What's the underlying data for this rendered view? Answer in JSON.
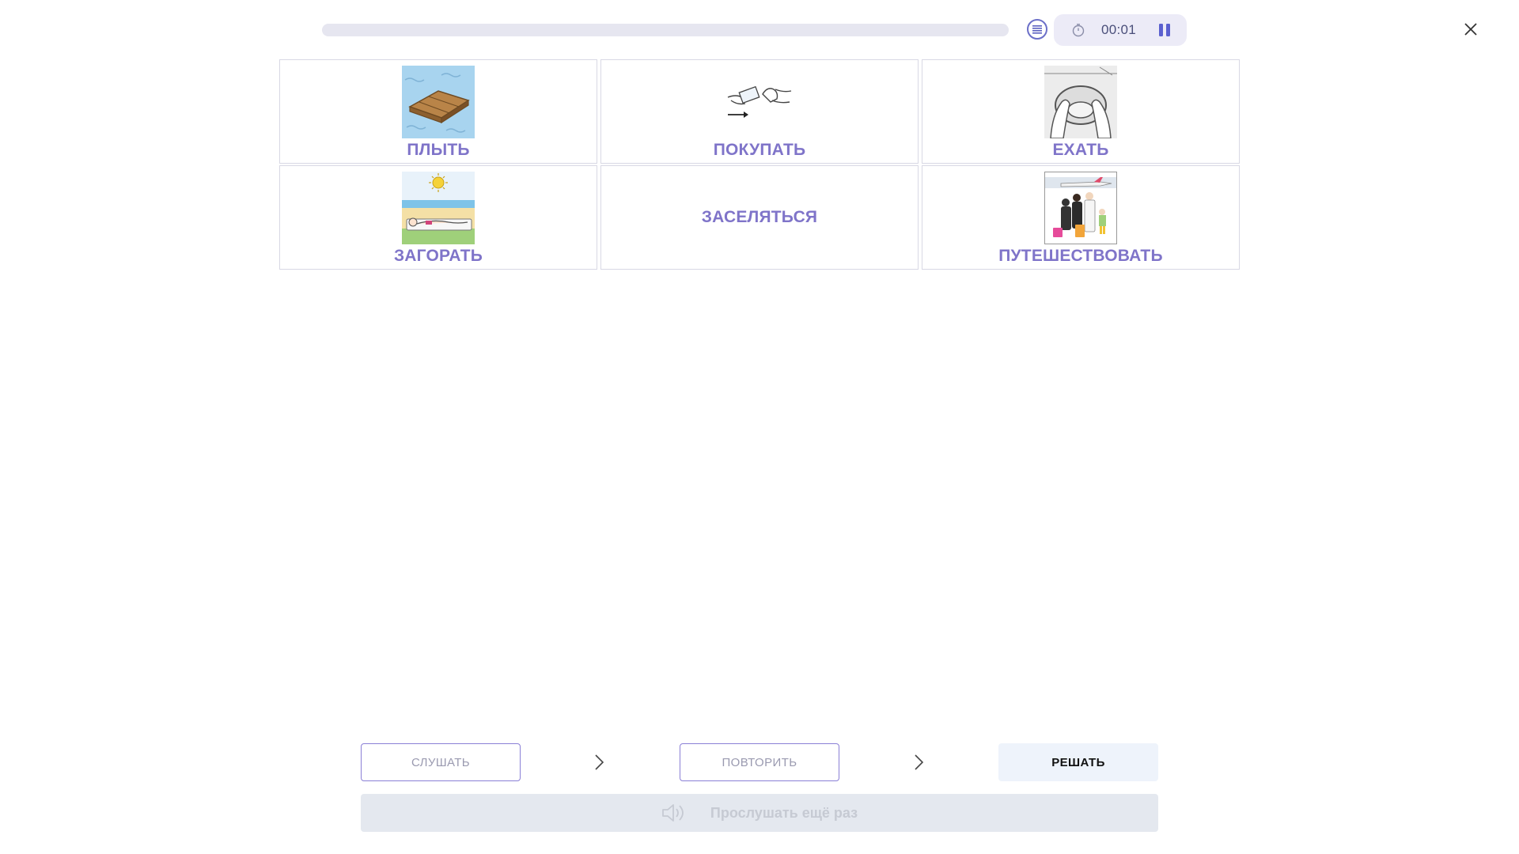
{
  "header": {
    "progress": 0,
    "timer": "00:01",
    "icons": {
      "list": "list-icon",
      "timer": "stopwatch-icon",
      "pause": "pause-icon",
      "close": "close-icon"
    }
  },
  "cards": [
    {
      "label": "ПЛЫТЬ",
      "picture": "raft-on-water"
    },
    {
      "label": "ПОКУПАТЬ",
      "picture": "paying-money"
    },
    {
      "label": "ЕХАТЬ",
      "picture": "steering-wheel"
    },
    {
      "label": "ЗАГОРАТЬ",
      "picture": "sunbathing-on-beach"
    },
    {
      "label": "ЗАСЕЛЯТЬСЯ",
      "picture": ""
    },
    {
      "label": "ПУТЕШЕСТВОВАТЬ",
      "picture": "family-at-airport"
    }
  ],
  "controls": {
    "listen_label": "СЛУШАТЬ",
    "repeat_label": "ПОВТОРИТЬ",
    "solve_label": "РЕШАТЬ",
    "replay_label": "Прослушать ещё раз"
  },
  "colors": {
    "accent": "#7f74c9",
    "progress_track": "#e6e6f0",
    "timer_bg": "#ecebf7",
    "solve_bg": "#eef3fb",
    "replay_bg": "#e4e8ef"
  }
}
